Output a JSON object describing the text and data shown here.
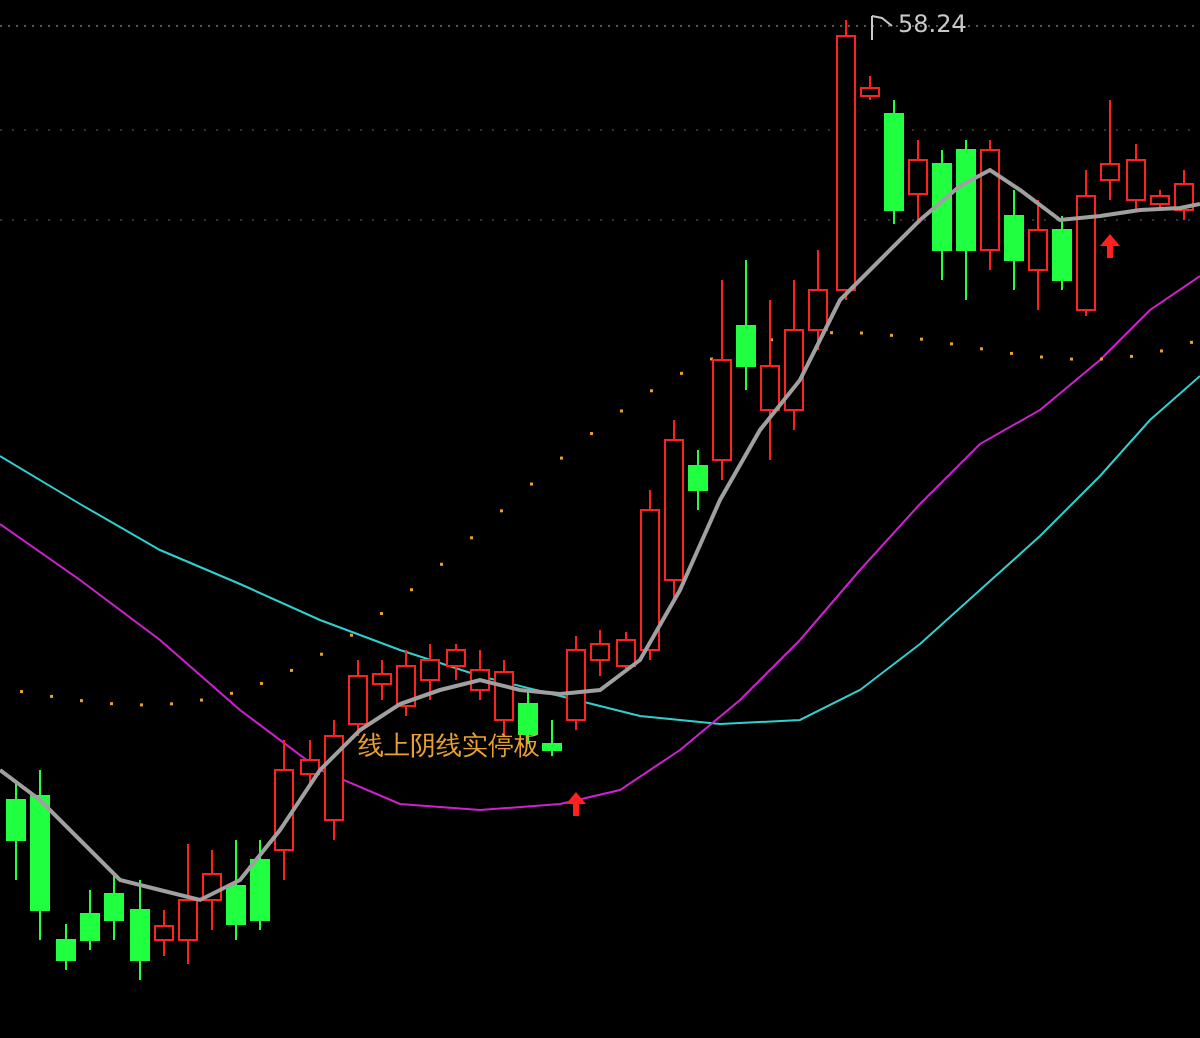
{
  "chart": {
    "peak_label": "58.24",
    "signal_text": "线上阴线实停板"
  }
}
